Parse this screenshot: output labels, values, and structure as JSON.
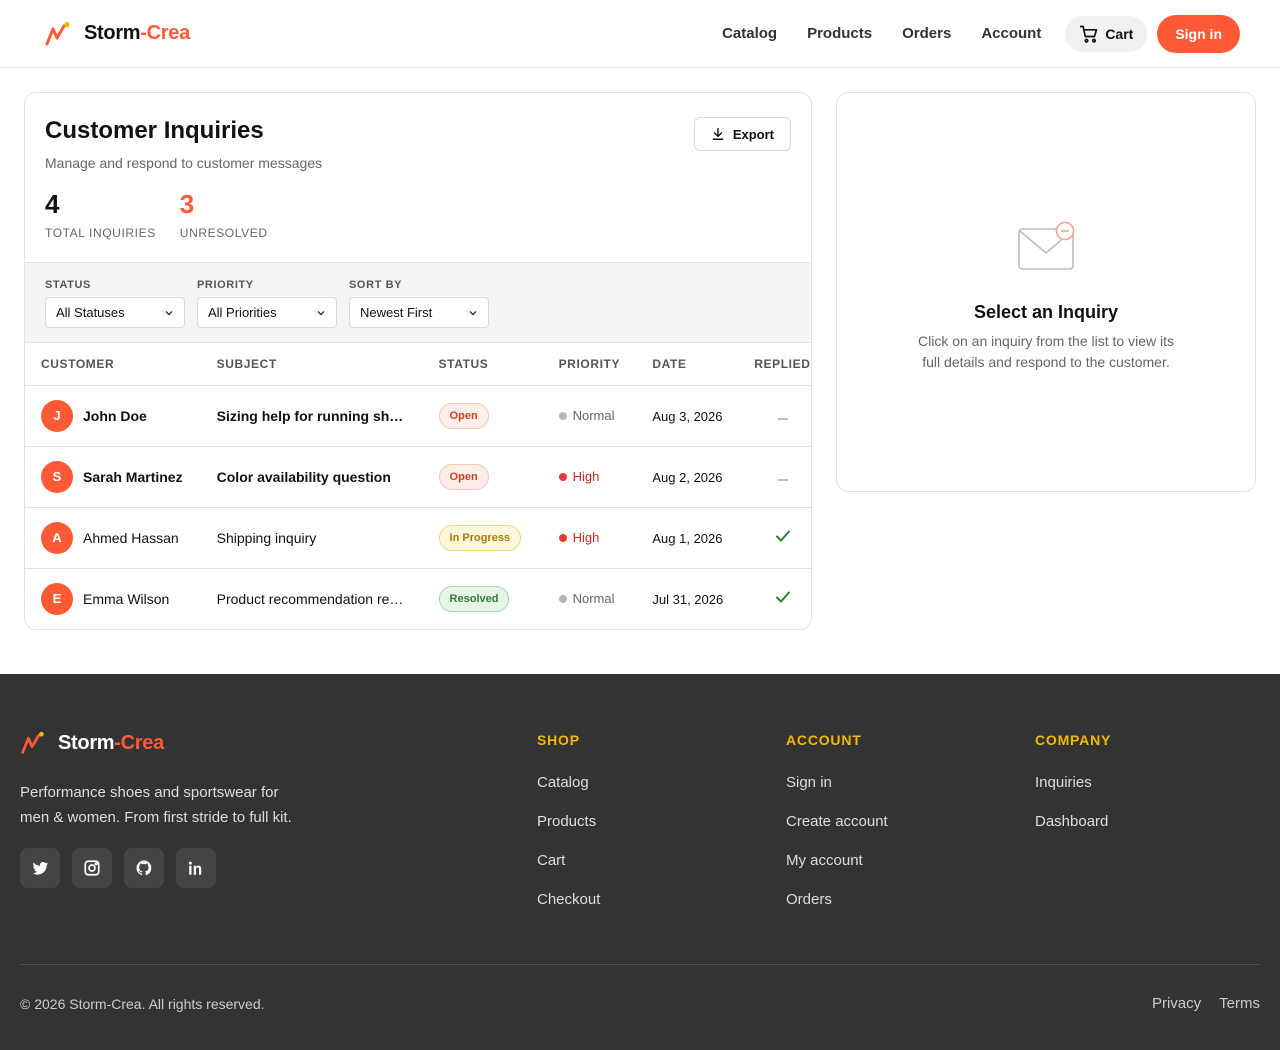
{
  "brand": {
    "name": "Storm",
    "accent": "-Crea"
  },
  "nav": {
    "links": [
      "Catalog",
      "Products",
      "Orders",
      "Account"
    ],
    "cart_label": "Cart",
    "signin_label": "Sign in"
  },
  "page": {
    "title": "Customer Inquiries",
    "subtitle": "Manage and respond to customer messages",
    "export_label": "Export",
    "stats": [
      {
        "value": "4",
        "label": "TOTAL INQUIRIES"
      },
      {
        "value": "3",
        "label": "UNRESOLVED"
      }
    ]
  },
  "filters": [
    {
      "label": "STATUS",
      "value": "All Statuses"
    },
    {
      "label": "PRIORITY",
      "value": "All Priorities"
    },
    {
      "label": "SORT BY",
      "value": "Newest First"
    }
  ],
  "table": {
    "headers": [
      "CUSTOMER",
      "SUBJECT",
      "STATUS",
      "PRIORITY",
      "DATE",
      "REPLIED"
    ],
    "rows": [
      {
        "initial": "J",
        "name": "John Doe",
        "subject": "Sizing help for running shoes",
        "status": "Open",
        "priority": "Normal",
        "date": "Aug 3, 2026",
        "replied": false,
        "unread": true
      },
      {
        "initial": "S",
        "name": "Sarah Martinez",
        "subject": "Color availability question",
        "status": "Open",
        "priority": "High",
        "date": "Aug 2, 2026",
        "replied": false,
        "unread": true
      },
      {
        "initial": "A",
        "name": "Ahmed Hassan",
        "subject": "Shipping inquiry",
        "status": "In Progress",
        "priority": "High",
        "date": "Aug 1, 2026",
        "replied": true,
        "unread": false
      },
      {
        "initial": "E",
        "name": "Emma Wilson",
        "subject": "Product recommendation request",
        "status": "Resolved",
        "priority": "Normal",
        "date": "Jul 31, 2026",
        "replied": true,
        "unread": false
      }
    ]
  },
  "detail": {
    "title": "Select an Inquiry",
    "subtitle": "Click on an inquiry from the list to view its full details and respond to the customer."
  },
  "footer": {
    "tagline": "Performance shoes and sportswear for men & women. From first stride to full kit.",
    "socials": [
      "twitter-icon",
      "instagram-icon",
      "github-icon",
      "linkedin-icon"
    ],
    "columns": [
      {
        "heading": "SHOP",
        "links": [
          "Catalog",
          "Products",
          "Cart",
          "Checkout"
        ]
      },
      {
        "heading": "ACCOUNT",
        "links": [
          "Sign in",
          "Create account",
          "My account",
          "Orders"
        ]
      },
      {
        "heading": "COMPANY",
        "links": [
          "Inquiries",
          "Dashboard"
        ]
      }
    ],
    "copyright": "© 2026 Storm-Crea. All rights reserved.",
    "legal": [
      "Privacy",
      "Terms"
    ]
  },
  "colors": {
    "accent": "#ff5a36",
    "footer_bg": "#333333",
    "footer_heading": "#f5b800"
  }
}
